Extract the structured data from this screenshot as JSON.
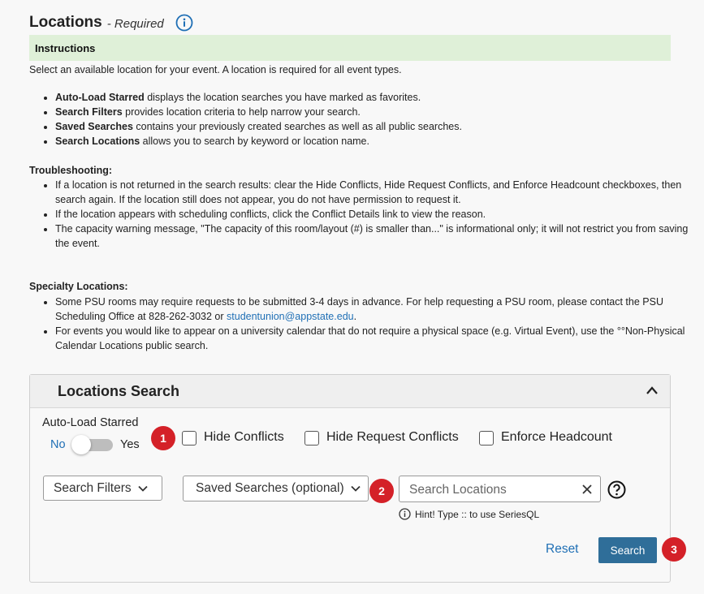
{
  "header": {
    "title": "Locations",
    "required": "- Required"
  },
  "instructions": {
    "heading": "Instructions",
    "intro": "Select an available location for your event. A location is required for all event types.",
    "items": [
      {
        "bold": "Auto-Load Starred",
        "text": " displays the location searches you have marked as favorites."
      },
      {
        "bold": "Search Filters",
        "text": " provides location criteria to help narrow your search."
      },
      {
        "bold": "Saved Searches",
        "text": " contains your previously created searches as well as all public searches."
      },
      {
        "bold": "Search Locations",
        "text": " allows you to search by keyword or location name."
      }
    ]
  },
  "troubleshooting": {
    "heading": "Troubleshooting:",
    "items": [
      "If a location is not returned in the search results: clear the Hide Conflicts, Hide Request Conflicts, and Enforce Headcount checkboxes, then search again. If the location still does not appear, you do not have permission to request it.",
      "If the location appears with scheduling conflicts, click the Conflict Details link to view the reason.",
      "The capacity warning message, \"The capacity of this room/layout (#) is smaller than...\" is informational only; it will not restrict you from saving the event."
    ]
  },
  "specialty": {
    "heading": "Specialty Locations:",
    "item1_text": "Some PSU rooms may require requests to be submitted 3-4 days in advance. For help requesting a PSU room, please contact the PSU Scheduling Office at 828-262-3032 or ",
    "item1_link": "studentunion@appstate.edu",
    "item1_end": ".",
    "item2": "For events you would like to appear on a university calendar that do not require a physical space (e.g. Virtual Event), use the °°Non-Physical Calendar Locations public search."
  },
  "search_panel": {
    "title": "Locations Search",
    "autoload_label": "Auto-Load Starred",
    "toggle_no": "No",
    "toggle_yes": "Yes",
    "checkboxes": [
      "Hide Conflicts",
      "Hide Request Conflicts",
      "Enforce Headcount"
    ],
    "filters_label": "Search Filters",
    "saved_label": "Saved Searches (optional)",
    "search_placeholder": "Search Locations",
    "hint": "Hint! Type :: to use SeriesQL",
    "reset_label": "Reset",
    "search_label": "Search"
  },
  "badges": [
    "1",
    "2",
    "3"
  ],
  "colors": {
    "accent": "#1f6fb5",
    "badge": "#d42128",
    "primary_button": "#2f6e99",
    "instructions_bg": "#dff0d8"
  }
}
